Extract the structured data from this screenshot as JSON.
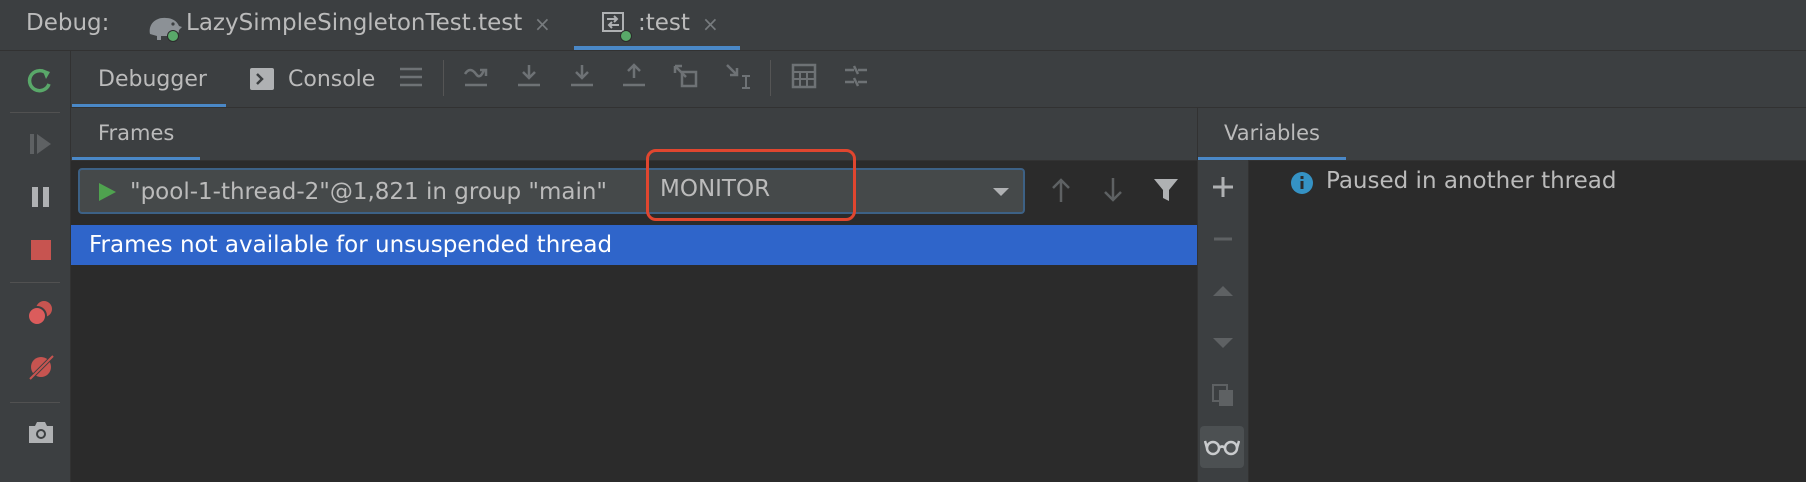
{
  "header": {
    "label": "Debug:",
    "tabs": [
      {
        "label": "LazySimpleSingletonTest.test",
        "icon": "gradle-elephant-icon",
        "active": false
      },
      {
        "label": ":test",
        "icon": "run-configuration-icon",
        "active": true
      }
    ],
    "close_glyph": "×"
  },
  "subtoolbar": {
    "tabs": [
      {
        "label": "Debugger",
        "active": true
      },
      {
        "label": "Console",
        "icon": "console-icon",
        "active": false
      }
    ],
    "actions": [
      "menu-icon",
      "show-execution-point-icon",
      "step-over-icon",
      "step-into-icon",
      "force-step-into-icon",
      "step-out-icon",
      "drop-frame-icon",
      "run-to-cursor-icon",
      "evaluate-expression-icon",
      "trace-icon"
    ]
  },
  "left_toolbar": {
    "actions": [
      "rerun-icon",
      "resume-icon",
      "pause-icon",
      "stop-icon",
      "view-breakpoints-icon",
      "mute-breakpoints-icon",
      "camera-icon"
    ]
  },
  "frames": {
    "title": "Frames",
    "thread": "\"pool-1-thread-2\"@1,821 in group \"main\"",
    "state": "MONITOR",
    "message": "Frames not available for unsuspended thread"
  },
  "variables": {
    "title": "Variables",
    "message": "Paused in another thread"
  },
  "colors": {
    "background": "#3c3f41",
    "panel": "#2b2b2b",
    "accent": "#4a88c7",
    "selection": "#2f65ca",
    "highlight": "#e0462f",
    "run_green": "#4fa34f",
    "stop_red": "#c75450"
  }
}
